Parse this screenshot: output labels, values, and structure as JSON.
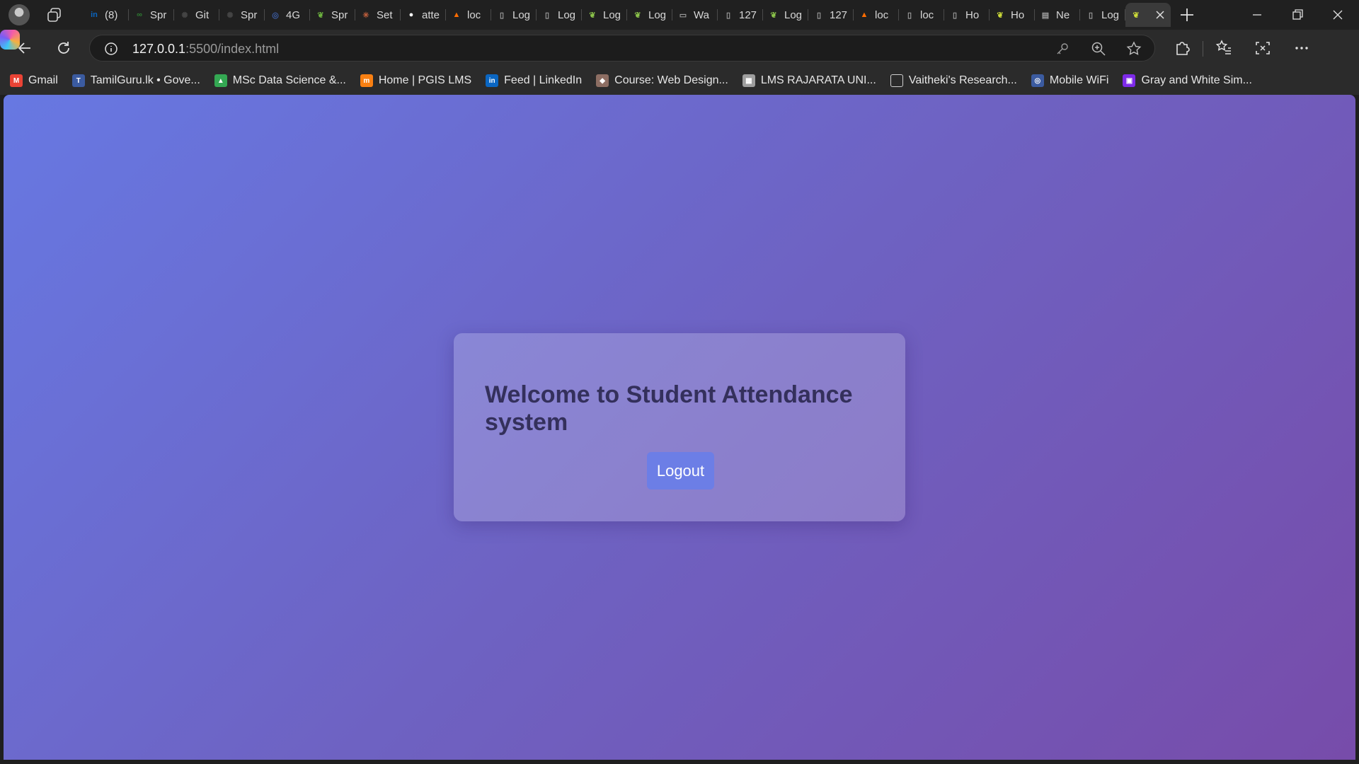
{
  "browser": {
    "tabs": [
      {
        "title": "(8)",
        "icon": "linkedin-icon",
        "color": "#0a66c2",
        "glyph": "in"
      },
      {
        "title": "Spr",
        "icon": "spring-icon",
        "color": "#2e7d32",
        "glyph": "∞"
      },
      {
        "title": "Git",
        "icon": "chatgpt-icon",
        "color": "#444444",
        "glyph": "✺"
      },
      {
        "title": "Spr",
        "icon": "chatgpt-icon",
        "color": "#444444",
        "glyph": "✺"
      },
      {
        "title": "4G",
        "icon": "router-icon",
        "color": "#3b5ba0",
        "glyph": "◎"
      },
      {
        "title": "Spr",
        "icon": "spring-leaf-icon",
        "color": "#6db33f",
        "glyph": "❦"
      },
      {
        "title": "Set",
        "icon": "claude-icon",
        "color": "#c15f3c",
        "glyph": "✳"
      },
      {
        "title": "atte",
        "icon": "github-icon",
        "color": "#ffffff",
        "glyph": "●"
      },
      {
        "title": "loc",
        "icon": "firebase-icon",
        "color": "#ff6d00",
        "glyph": "▲"
      },
      {
        "title": "Log",
        "icon": "page-icon",
        "color": "#9e9e9e",
        "glyph": "▯"
      },
      {
        "title": "Log",
        "icon": "page-icon",
        "color": "#9e9e9e",
        "glyph": "▯"
      },
      {
        "title": "Log",
        "icon": "mongodb-leaf-icon",
        "color": "#8bc34a",
        "glyph": "❦"
      },
      {
        "title": "Log",
        "icon": "mongodb-leaf-icon",
        "color": "#8bc34a",
        "glyph": "❦"
      },
      {
        "title": "Wa",
        "icon": "wallet-icon",
        "color": "#9e9e9e",
        "glyph": "▭"
      },
      {
        "title": "127",
        "icon": "page-error-icon",
        "color": "#9e9e9e",
        "glyph": "▯"
      },
      {
        "title": "Log",
        "icon": "mongodb-leaf-icon",
        "color": "#8bc34a",
        "glyph": "❦"
      },
      {
        "title": "127",
        "icon": "page-icon",
        "color": "#9e9e9e",
        "glyph": "▯"
      },
      {
        "title": "loc",
        "icon": "firebase-icon",
        "color": "#ff6d00",
        "glyph": "▲"
      },
      {
        "title": "loc",
        "icon": "page-error-icon",
        "color": "#9e9e9e",
        "glyph": "▯"
      },
      {
        "title": "Ho",
        "icon": "page-icon",
        "color": "#9e9e9e",
        "glyph": "▯"
      },
      {
        "title": "Ho",
        "icon": "mongodb-leaf-icon",
        "color": "#cddc39",
        "glyph": "❦"
      },
      {
        "title": "Ne",
        "icon": "new-tab-icon",
        "color": "#9e9e9e",
        "glyph": "▤"
      },
      {
        "title": "Log",
        "icon": "page-icon",
        "color": "#9e9e9e",
        "glyph": "▯"
      },
      {
        "title": "",
        "icon": "mongodb-leaf-icon",
        "color": "#cddc39",
        "glyph": "❦",
        "active": true
      }
    ],
    "address": {
      "host": "127.0.0.1",
      "path": ":5500/index.html"
    },
    "bookmarks": [
      {
        "label": "Gmail",
        "icon": "gmail-icon",
        "color": "#ea4335",
        "glyph": "M"
      },
      {
        "label": "TamilGuru.lk • Gove...",
        "icon": "tamilguru-icon",
        "color": "#3b5ba0",
        "glyph": "T"
      },
      {
        "label": "MSc Data Science &...",
        "icon": "google-drive-icon",
        "color": "#34a853",
        "glyph": "▲"
      },
      {
        "label": "Home | PGIS LMS",
        "icon": "moodle-icon",
        "color": "#f98012",
        "glyph": "m"
      },
      {
        "label": "Feed | LinkedIn",
        "icon": "linkedin-icon",
        "color": "#0a66c2",
        "glyph": "in"
      },
      {
        "label": "Course: Web Design...",
        "icon": "university-crest-icon",
        "color": "#8d6e63",
        "glyph": "◆"
      },
      {
        "label": "LMS RAJARATA UNI...",
        "icon": "lms-icon",
        "color": "#9e9e9e",
        "glyph": "▦"
      },
      {
        "label": "Vaitheki's Research...",
        "icon": "folder-icon",
        "color": "#2b2b2b",
        "glyph": "▭"
      },
      {
        "label": "Mobile WiFi",
        "icon": "router-icon",
        "color": "#3b5ba0",
        "glyph": "◎"
      },
      {
        "label": "Gray and White Sim...",
        "icon": "canva-icon",
        "color": "#7d2ae8",
        "glyph": "▣"
      }
    ]
  },
  "page": {
    "heading": "Welcome to Student Attendance system",
    "logout_label": "Logout",
    "colors": {
      "gradient_start": "#6778e2",
      "gradient_end": "#774caa",
      "button": "#6c7ee6",
      "heading": "#34305c"
    }
  }
}
